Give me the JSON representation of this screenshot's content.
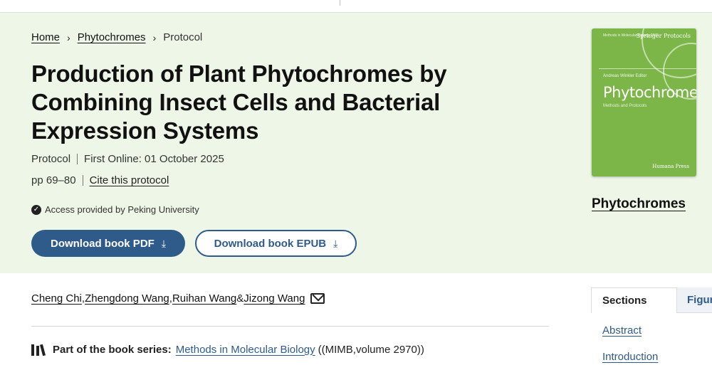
{
  "breadcrumb": {
    "home": "Home",
    "book": "Phytochromes",
    "current": "Protocol",
    "separator": "›"
  },
  "article": {
    "title": "Production of Plant Phytochromes by Combining Insect Cells and Bacterial Expression Systems",
    "type": "Protocol",
    "first_online": "First Online: 01 October 2025",
    "pages": "pp 69–80",
    "cite": "Cite this protocol",
    "access": "Access provided by Peking University"
  },
  "buttons": {
    "pdf": "Download book PDF",
    "epub": "Download book EPUB"
  },
  "cover": {
    "series": "Methods in Molecular Biology 2970",
    "brand": "Springer Protocols",
    "editor": "Andreas Winkler Editor",
    "title": "Phytochromes",
    "subtitle": "Methods and Protocols",
    "publisher": "Humana Press",
    "color": "#7cb548"
  },
  "book_link": "Phytochromes",
  "authors": [
    "Cheng Chi",
    "Zhengdong Wang",
    "Ruihan Wang",
    "Jizong Wang"
  ],
  "author_separators": [
    ", ",
    ", ",
    " & "
  ],
  "series": {
    "label": "Part of the book series:",
    "name": "Methods in Molecular Biology",
    "suffix": "((MIMB,volume 2970))"
  },
  "side_tabs": [
    "Sections",
    "Figures"
  ],
  "side_links": [
    "Abstract",
    "Introduction"
  ],
  "colors": {
    "accent": "#2e5b8a",
    "hero_bg": "#eef7e7"
  }
}
